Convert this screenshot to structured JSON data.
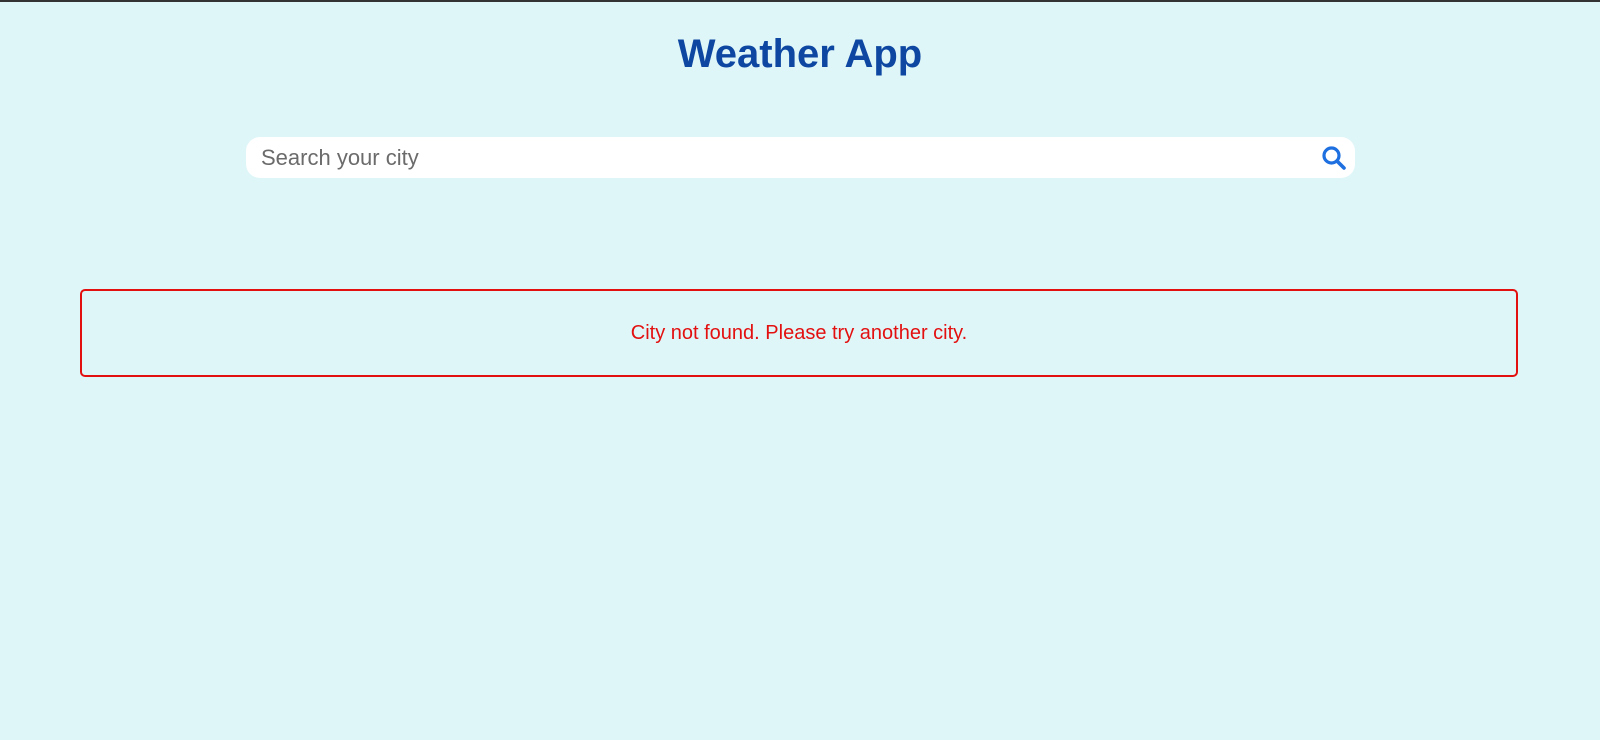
{
  "header": {
    "title": "Weather App"
  },
  "search": {
    "placeholder": "Search your city",
    "value": "",
    "icon": "search-icon"
  },
  "error": {
    "message": "City not found. Please try another city."
  },
  "colors": {
    "background": "#dff6f9",
    "title": "#0d47a1",
    "search_icon": "#1e6fe0",
    "error": "#e31010"
  }
}
